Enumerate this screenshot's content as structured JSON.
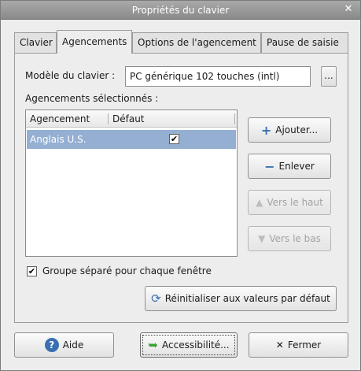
{
  "window": {
    "title": "Propriétés du clavier"
  },
  "tabs": [
    {
      "label": "Clavier"
    },
    {
      "label": "Agencements"
    },
    {
      "label": "Options de l'agencement"
    },
    {
      "label": "Pause de saisie"
    }
  ],
  "model": {
    "label": "Modèle du clavier :",
    "value": "PC générique 102 touches (intl)",
    "more": "..."
  },
  "layouts": {
    "label": "Agencements sélectionnés :",
    "columns": [
      "Agencement",
      "Défaut"
    ],
    "rows": [
      {
        "name": "Anglais U.S.",
        "default": true
      }
    ]
  },
  "side_buttons": {
    "add": "Ajouter...",
    "remove": "Enlever",
    "up": "Vers le haut",
    "down": "Vers le bas"
  },
  "group_check": {
    "label": "Groupe séparé pour chaque fenêtre",
    "checked": true
  },
  "reset": {
    "label": "Réinitialiser aux valeurs par défaut"
  },
  "footer": {
    "help": "Aide",
    "accessibility": "Accessibilité...",
    "close": "Fermer"
  },
  "colors": {
    "selection": "#94afd2",
    "accent_blue": "#3b6fb3",
    "green": "#3aa335"
  }
}
